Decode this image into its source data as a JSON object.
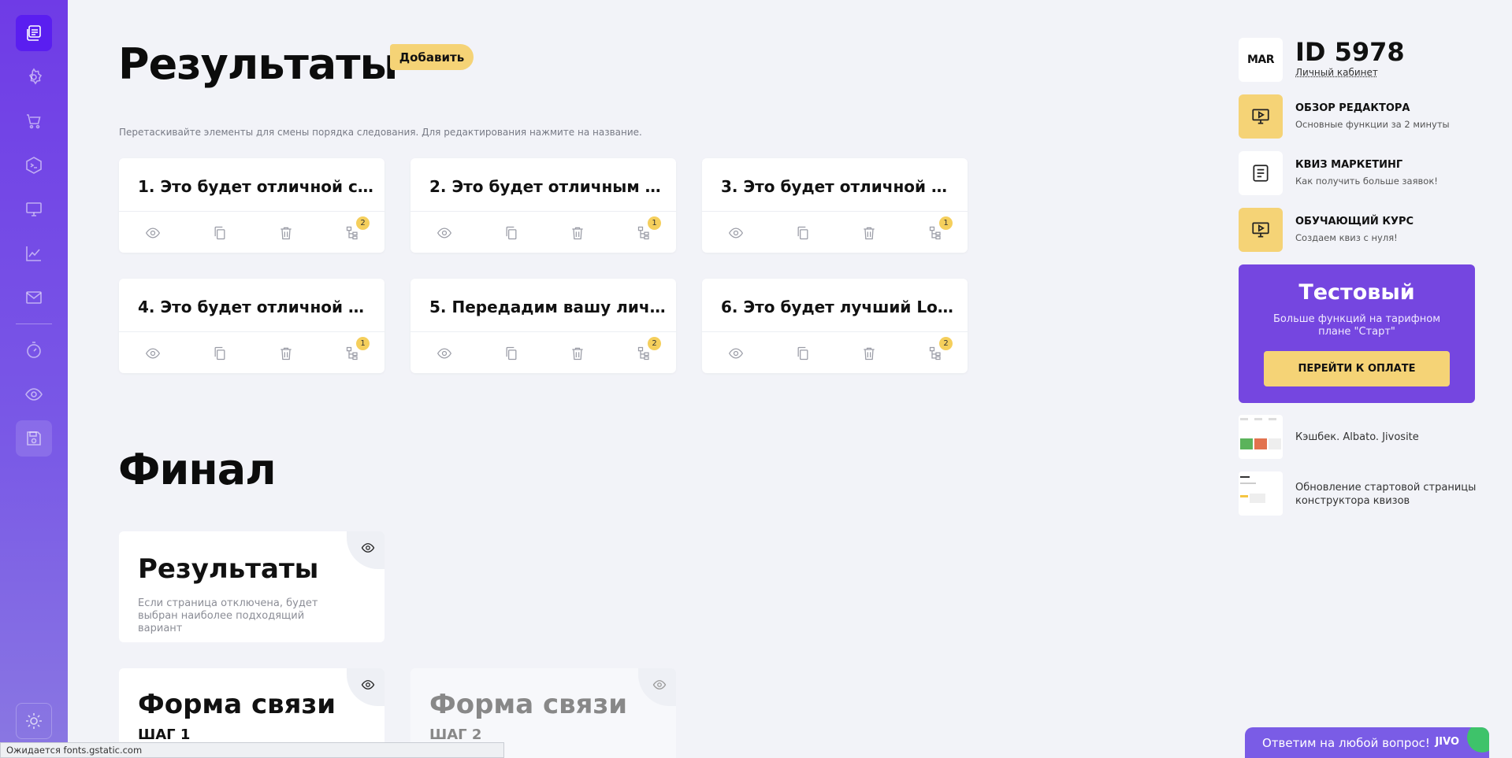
{
  "sidebar": {
    "items": [
      {
        "name": "questions-icon",
        "active": true
      },
      {
        "name": "settings-icon"
      },
      {
        "name": "cart-icon"
      },
      {
        "name": "code-icon"
      },
      {
        "name": "monitor-icon"
      },
      {
        "name": "analytics-icon"
      },
      {
        "name": "mail-icon"
      },
      {
        "name": "timer-icon"
      },
      {
        "name": "preview-icon"
      },
      {
        "name": "save-icon"
      }
    ],
    "theme_icon": "sun-icon"
  },
  "main": {
    "title": "Результаты",
    "add_label": "Добавить",
    "hint": "Перетаскивайте элементы для смены порядка следования. Для редактирования нажмите на название.",
    "results": [
      {
        "title": "1. Это будет отличной с...",
        "badge": "2"
      },
      {
        "title": "2. Это будет отличным о...",
        "badge": "1"
      },
      {
        "title": "3. Это будет отличной р...",
        "badge": "1"
      },
      {
        "title": "4. Это будет отличной р...",
        "badge": "1"
      },
      {
        "title": "5. Передадим вашу лич...",
        "badge": "2"
      },
      {
        "title": "6. Это будет лучший Lov...",
        "badge": "2"
      }
    ],
    "final_title": "Финал",
    "final_cards": [
      {
        "title": "Результаты",
        "sub": "Если страница отключена, будет выбран наиболее подходящий вариант"
      },
      {
        "title": "Форма связи",
        "step": "ШАГ 1"
      },
      {
        "title": "Форма связи",
        "step": "ШАГ 2"
      }
    ]
  },
  "right": {
    "id": "ID 5978",
    "cabinet": "Личный кабинет",
    "logo": "MAR",
    "links": [
      {
        "title": "ОБЗОР РЕДАКТОРА",
        "desc": "Основные функции за 2 минуты",
        "icon": "video-icon",
        "color": "#f5d376"
      },
      {
        "title": "КВИЗ МАРКЕТИНГ",
        "desc": "Как получить больше заявок!",
        "icon": "document-icon",
        "color": "#ffffff"
      },
      {
        "title": "ОБУЧАЮЩИЙ КУРС",
        "desc": "Создаем квиз с нуля!",
        "icon": "video-icon",
        "color": "#f5d376"
      }
    ],
    "plan": {
      "name": "Тестовый",
      "desc": "Больше функций на тарифном плане \"Старт\"",
      "button": "ПЕРЕЙТИ К ОПЛАТЕ"
    },
    "news": [
      {
        "title": "Кэшбек. Albato. Jivosite"
      },
      {
        "title": "Обновление стартовой страницы конструктора квизов"
      }
    ]
  },
  "status_bar": "Ожидается fonts.gstatic.com",
  "chat": {
    "label": "Ответим на любой вопрос!",
    "logo": "JIVO"
  }
}
